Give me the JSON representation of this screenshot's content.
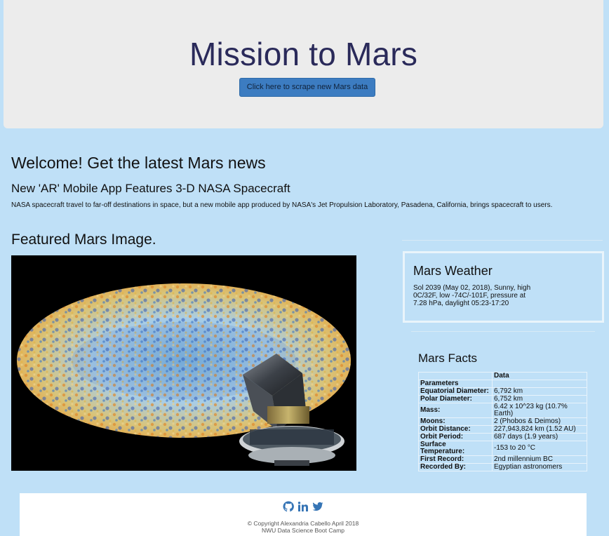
{
  "header": {
    "title": "Mission to Mars",
    "scrape_button_label": "Click here to scrape new Mars data"
  },
  "news": {
    "heading": "Welcome! Get the latest Mars news",
    "title": "New 'AR' Mobile App Features 3-D NASA Spacecraft",
    "paragraph": "NASA spacecraft travel to far-off destinations in space, but a new mobile app produced by NASA's Jet Propulsion Laboratory, Pasadena, California, brings spacecraft to users."
  },
  "featured": {
    "heading": "Featured Mars Image."
  },
  "weather": {
    "heading": "Mars Weather",
    "text": "Sol 2039 (May 02, 2018), Sunny, high 0C/32F, low -74C/-101F, pressure at 7.28 hPa, daylight 05:23-17:20"
  },
  "facts": {
    "heading": "Mars Facts",
    "column_header": "Data",
    "index_header": "Parameters",
    "rows": [
      {
        "label": "Equatorial Diameter:",
        "value": "6,792 km"
      },
      {
        "label": "Polar Diameter:",
        "value": "6,752 km"
      },
      {
        "label": "Mass:",
        "value": "6.42 x 10^23 kg (10.7% Earth)"
      },
      {
        "label": "Moons:",
        "value": "2 (Phobos & Deimos)"
      },
      {
        "label": "Orbit Distance:",
        "value": "227,943,824 km (1.52 AU)"
      },
      {
        "label": "Orbit Period:",
        "value": "687 days (1.9 years)"
      },
      {
        "label": "Surface Temperature:",
        "value": "-153 to 20 °C"
      },
      {
        "label": "First Record:",
        "value": "2nd millennium BC"
      },
      {
        "label": "Recorded By:",
        "value": "Egyptian astronomers"
      }
    ]
  },
  "footer": {
    "icons": [
      "github-icon",
      "linkedin-icon",
      "twitter-icon"
    ],
    "copyright": "© Copyright Alexandria Cabello April 2018",
    "bootcamp": "NWU Data Science Boot Camp"
  },
  "colors": {
    "page_background": "#bfe0f7",
    "jumbotron": "#ececec",
    "button": "#3c7cc1",
    "title": "#2a2a5a",
    "social_icons": "#3574b5"
  }
}
